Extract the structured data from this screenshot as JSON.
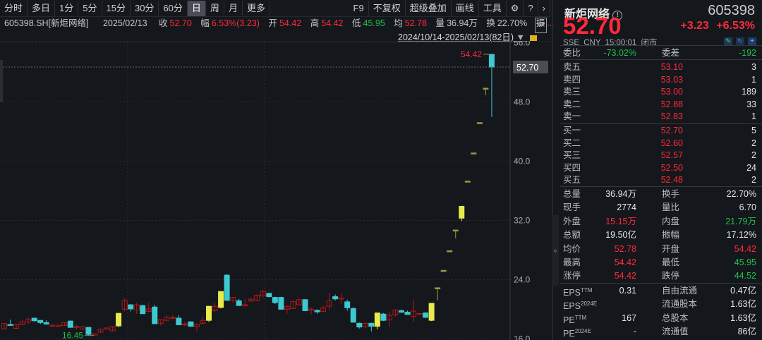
{
  "toolbar": {
    "periods": [
      "分时",
      "多日",
      "1分",
      "5分",
      "15分",
      "30分",
      "60分",
      "日",
      "周",
      "月",
      "更多"
    ],
    "active": "日",
    "right": [
      "F9",
      "不复权",
      "超级叠加",
      "画线",
      "工具"
    ]
  },
  "info": {
    "code": "605398.SH[新炬网络]",
    "date": "2025/02/13",
    "close_label": "收",
    "close": "52.70",
    "amp_label": "幅",
    "amp": "6.53%(3.23)",
    "open_label": "开",
    "open": "54.42",
    "high_label": "高",
    "high": "54.42",
    "low_label": "低",
    "low": "45.95",
    "avg_label": "均",
    "avg": "52.78",
    "vol_label": "量",
    "vol": "36.94万",
    "turn_label": "换",
    "turn": "22.70%",
    "zhen_label": "振",
    "more": "...",
    "range": "2024/10/14-2025/02/13(82日)"
  },
  "chart_data": {
    "type": "candlestick",
    "y_ticks": [
      "56.0",
      "48.0",
      "40.0",
      "32.0",
      "24.0",
      "16.0"
    ],
    "y_tick_values": [
      56,
      48,
      40,
      32,
      24,
      16
    ],
    "last_price": "52.70",
    "max_label": "54.42",
    "min_label": "16.45",
    "candles": [
      [
        17.36,
        18.1,
        17.3,
        18.07
      ],
      [
        17.95,
        18.6,
        17.8,
        17.86
      ],
      [
        17.42,
        18.0,
        17.4,
        18.0
      ],
      [
        17.9,
        18.5,
        17.85,
        18.3
      ],
      [
        18.27,
        18.9,
        18.0,
        18.6
      ],
      [
        18.8,
        18.8,
        18.3,
        18.45
      ],
      [
        18.5,
        18.55,
        18.0,
        18.2
      ],
      [
        18.2,
        18.5,
        17.9,
        18.0
      ],
      [
        17.8,
        18.0,
        17.6,
        17.85
      ],
      [
        17.7,
        17.9,
        17.65,
        17.85
      ],
      [
        17.8,
        18.25,
        17.75,
        18.2
      ],
      [
        18.4,
        18.5,
        17.5,
        17.55
      ],
      [
        17.65,
        17.9,
        17.2,
        17.68
      ],
      [
        17.33,
        17.7,
        17.3,
        17.65
      ],
      [
        17.55,
        17.6,
        16.5,
        16.6
      ],
      [
        16.5,
        16.75,
        16.45,
        16.7
      ],
      [
        16.9,
        17.4,
        16.8,
        17.3
      ],
      [
        17.45,
        17.6,
        17.3,
        17.47
      ],
      [
        17.1,
        17.7,
        17.05,
        17.65
      ],
      [
        17.75,
        19.45,
        17.6,
        19.45
      ],
      [
        20.0,
        21.5,
        19.7,
        21.2
      ],
      [
        20.6,
        20.7,
        19.7,
        20.05
      ],
      [
        19.9,
        20.9,
        19.4,
        20.6
      ],
      [
        20.5,
        20.6,
        19.4,
        19.4
      ],
      [
        19.7,
        20.95,
        19.6,
        20.05
      ],
      [
        20.3,
        20.6,
        18.05,
        18.05
      ],
      [
        18.1,
        18.6,
        17.8,
        18.6
      ],
      [
        18.5,
        19.2,
        18.4,
        18.9
      ],
      [
        18.9,
        19.2,
        18.6,
        18.92
      ],
      [
        18.8,
        19.2,
        17.9,
        17.9
      ],
      [
        18.0,
        18.3,
        17.7,
        18.02
      ],
      [
        18.3,
        18.4,
        17.7,
        17.7
      ],
      [
        17.65,
        18.0,
        17.0,
        18.0
      ],
      [
        18.1,
        19.1,
        18.0,
        18.5
      ],
      [
        18.5,
        20.4,
        18.3,
        20.4
      ],
      [
        19.8,
        20.9,
        19.6,
        20.4
      ],
      [
        20.25,
        22.4,
        20.1,
        22.4
      ],
      [
        24.6,
        24.75,
        21.2,
        21.2
      ],
      [
        21.2,
        21.6,
        20.9,
        21.6
      ],
      [
        21.15,
        21.4,
        20.5,
        20.5
      ],
      [
        20.6,
        21.4,
        20.3,
        20.62
      ],
      [
        21.1,
        21.6,
        21.0,
        21.35
      ],
      [
        21.15,
        22.0,
        21.1,
        21.9
      ],
      [
        21.8,
        22.6,
        21.6,
        22.45
      ],
      [
        22.15,
        22.2,
        21.6,
        21.7
      ],
      [
        21.6,
        21.7,
        20.7,
        20.9
      ],
      [
        21.6,
        21.7,
        20.0,
        20.0
      ],
      [
        20.0,
        20.5,
        19.4,
        20.4
      ],
      [
        20.1,
        21.1,
        20.0,
        21.05
      ],
      [
        20.6,
        21.4,
        20.5,
        21.3
      ],
      [
        21.3,
        21.4,
        19.8,
        19.8
      ],
      [
        20.0,
        20.3,
        19.3,
        20.02
      ],
      [
        19.85,
        20.0,
        19.4,
        19.65
      ],
      [
        19.7,
        20.5,
        19.6,
        20.2
      ],
      [
        20.4,
        22.2,
        19.9,
        21.15
      ],
      [
        21.7,
        22.0,
        21.2,
        21.4
      ],
      [
        21.5,
        22.2,
        20.7,
        21.52
      ],
      [
        21.0,
        21.3,
        19.8,
        20.2
      ],
      [
        20.1,
        20.3,
        18.2,
        18.25
      ],
      [
        18.1,
        18.2,
        17.4,
        17.6
      ],
      [
        17.65,
        18.2,
        17.5,
        18.1
      ],
      [
        18.1,
        18.2,
        17.0,
        17.7
      ],
      [
        17.7,
        19.5,
        17.3,
        19.5
      ],
      [
        19.35,
        19.5,
        18.4,
        18.5
      ],
      [
        18.55,
        19.7,
        17.6,
        19.2
      ],
      [
        19.25,
        20.0,
        19.0,
        19.9
      ],
      [
        19.8,
        20.0,
        19.5,
        19.6
      ],
      [
        19.6,
        19.8,
        19.3,
        19.3
      ],
      [
        19.0,
        21.3,
        18.3,
        19.75
      ],
      [
        19.4,
        19.5,
        19.3,
        19.42
      ],
      [
        19.5,
        19.6,
        18.8,
        18.9
      ],
      [
        18.5,
        20.8,
        18.4,
        20.8
      ],
      [
        22.9,
        22.9,
        21.2,
        22.9
      ],
      [
        25.25,
        25.25,
        25.25,
        25.25
      ],
      [
        27.9,
        27.9,
        27.9,
        27.9
      ],
      [
        30.7,
        30.7,
        29.6,
        30.7
      ],
      [
        32.3,
        33.9,
        31.9,
        33.9
      ],
      [
        37.3,
        37.3,
        37.3,
        37.3
      ],
      [
        41.1,
        41.1,
        41.1,
        41.1
      ],
      [
        45.2,
        45.2,
        45.2,
        45.2
      ],
      [
        49.85,
        49.85,
        48.9,
        49.85
      ],
      [
        54.42,
        54.42,
        45.95,
        52.7
      ]
    ],
    "limit_up_days": [
      19,
      34,
      36,
      62,
      71,
      72,
      73,
      74,
      75,
      76,
      77,
      78,
      79,
      80
    ]
  },
  "panel": {
    "name": "新炬网络",
    "code": "605398",
    "price": "52.70",
    "change": "+3.23",
    "pct": "+6.53%",
    "sub": "SSE CNY 15:00:01 闭市",
    "wb_label": "委比",
    "wb": "-73.02%",
    "wc_label": "委差",
    "wc": "-192",
    "sell": [
      {
        "l": "卖五",
        "p": "53.10",
        "v": "3"
      },
      {
        "l": "卖四",
        "p": "53.03",
        "v": "1"
      },
      {
        "l": "卖三",
        "p": "53.00",
        "v": "189"
      },
      {
        "l": "卖二",
        "p": "52.88",
        "v": "33"
      },
      {
        "l": "卖一",
        "p": "52.83",
        "v": "1"
      }
    ],
    "buy": [
      {
        "l": "买一",
        "p": "52.70",
        "v": "5"
      },
      {
        "l": "买二",
        "p": "52.60",
        "v": "2"
      },
      {
        "l": "买三",
        "p": "52.57",
        "v": "2"
      },
      {
        "l": "买四",
        "p": "52.50",
        "v": "24"
      },
      {
        "l": "买五",
        "p": "52.48",
        "v": "2"
      }
    ],
    "stats": [
      [
        "总量",
        "36.94万",
        "white",
        "换手",
        "22.70%",
        "white"
      ],
      [
        "现手",
        "2774",
        "white",
        "量比",
        "6.70",
        "white"
      ],
      [
        "外盘",
        "15.15万",
        "red",
        "内盘",
        "21.79万",
        "green"
      ],
      [
        "总额",
        "19.50亿",
        "white",
        "振幅",
        "17.12%",
        "white"
      ],
      [
        "均价",
        "52.78",
        "red",
        "开盘",
        "54.42",
        "red"
      ],
      [
        "最高",
        "54.42",
        "red",
        "最低",
        "45.95",
        "green"
      ],
      [
        "涨停",
        "54.42",
        "red",
        "跌停",
        "44.52",
        "green"
      ]
    ],
    "fin": [
      [
        "EPS",
        "TTM",
        "0.31",
        "自由流通",
        "0.47亿"
      ],
      [
        "EPS",
        "2024E",
        "",
        "流通股本",
        "1.63亿"
      ],
      [
        "PE",
        "TTM",
        "167",
        "总股本",
        "1.63亿"
      ],
      [
        "PE",
        "2024E",
        "-",
        "流通值",
        "86亿"
      ]
    ]
  },
  "colors": {
    "up": "#ff2a3a",
    "down": "#1fc14a",
    "candle_up": "#b01818",
    "candle_down": "#3cc9d0",
    "limit": "#e8ec4a"
  }
}
